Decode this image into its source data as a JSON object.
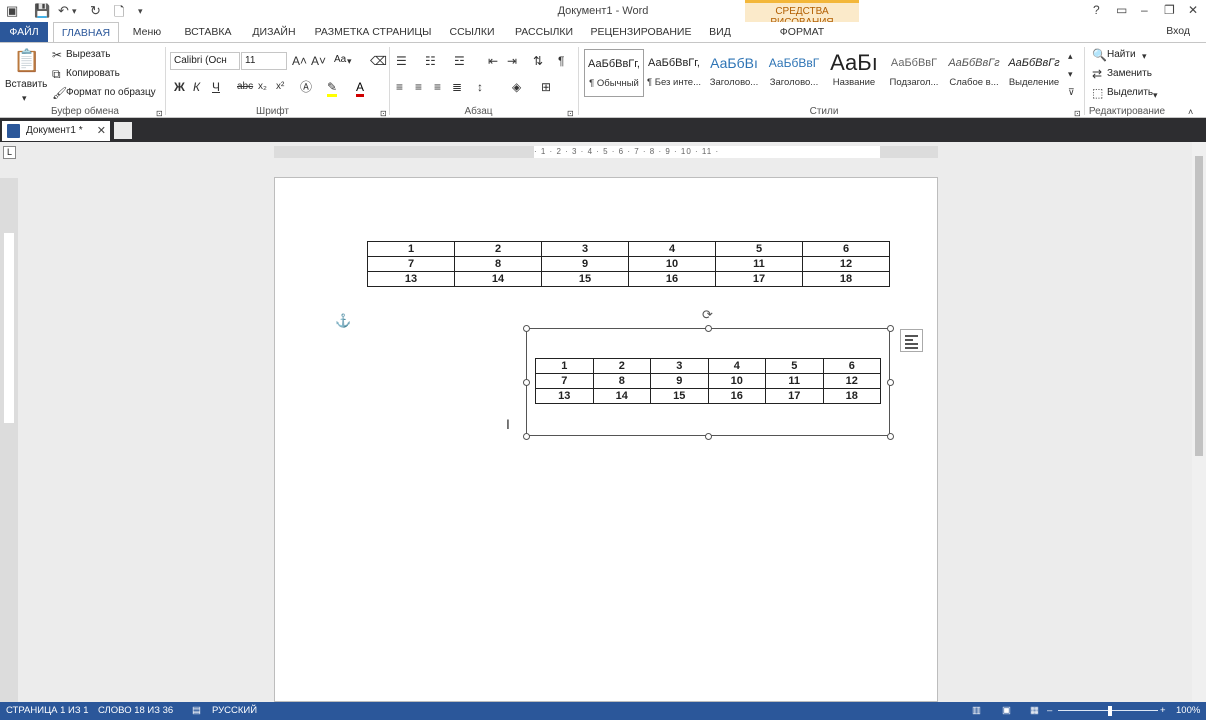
{
  "window": {
    "title": "Документ1 - Word",
    "context_tab_header": "СРЕДСТВА РИСОВАНИЯ",
    "sign_in": "Вход"
  },
  "tabs": [
    {
      "label": "ФАЙЛ"
    },
    {
      "label": "ГЛАВНАЯ"
    },
    {
      "label": "Меню"
    },
    {
      "label": "ВСТАВКА"
    },
    {
      "label": "ДИЗАЙН"
    },
    {
      "label": "РАЗМЕТКА СТРАНИЦЫ"
    },
    {
      "label": "ССЫЛКИ"
    },
    {
      "label": "РАССЫЛКИ"
    },
    {
      "label": "РЕЦЕНЗИРОВАНИЕ"
    },
    {
      "label": "ВИД"
    },
    {
      "label": "ФОРМАТ"
    }
  ],
  "clipboard": {
    "paste": "Вставить",
    "cut": "Вырезать",
    "copy": "Копировать",
    "format_painter": "Формат по образцу",
    "label": "Буфер обмена"
  },
  "font": {
    "name": "Calibri (Осн",
    "size": "11",
    "case_btn": "Aa",
    "label": "Шрифт"
  },
  "paragraph": {
    "label": "Абзац"
  },
  "styles": {
    "items": [
      {
        "sample": "АаБбВвГг,",
        "name": "¶ Обычный"
      },
      {
        "sample": "АаБбВвГг,",
        "name": "¶ Без инте..."
      },
      {
        "sample": "АаБбВı",
        "name": "Заголово..."
      },
      {
        "sample": "АаБбВвГ",
        "name": "Заголово..."
      },
      {
        "sample": "АаБı",
        "name": "Название"
      },
      {
        "sample": "АаБбВвГ",
        "name": "Подзагол..."
      },
      {
        "sample": "АаБбВвГг",
        "name": "Слабое в..."
      },
      {
        "sample": "АаБбВвГг",
        "name": "Выделение"
      }
    ],
    "label": "Стили"
  },
  "editing": {
    "find": "Найти",
    "replace": "Заменить",
    "select": "Выделить",
    "label": "Редактирование"
  },
  "doc_tab": {
    "label": "Документ1 *"
  },
  "ruler_marks": "· 1 · 2 · 3 · 4 · 5 · 6 · 7 · 8 · 9 · 10 · 11 ·",
  "table_top": [
    [
      "1",
      "2",
      "3",
      "4",
      "5",
      "6"
    ],
    [
      "7",
      "8",
      "9",
      "10",
      "11",
      "12"
    ],
    [
      "13",
      "14",
      "15",
      "16",
      "17",
      "18"
    ]
  ],
  "table_inner": [
    [
      "1",
      "2",
      "3",
      "4",
      "5",
      "6"
    ],
    [
      "7",
      "8",
      "9",
      "10",
      "11",
      "12"
    ],
    [
      "13",
      "14",
      "15",
      "16",
      "17",
      "18"
    ]
  ],
  "status": {
    "page": "СТРАНИЦА 1 ИЗ 1",
    "words": "СЛОВО 18 ИЗ 36",
    "language": "РУССКИЙ",
    "zoom": "100%"
  }
}
